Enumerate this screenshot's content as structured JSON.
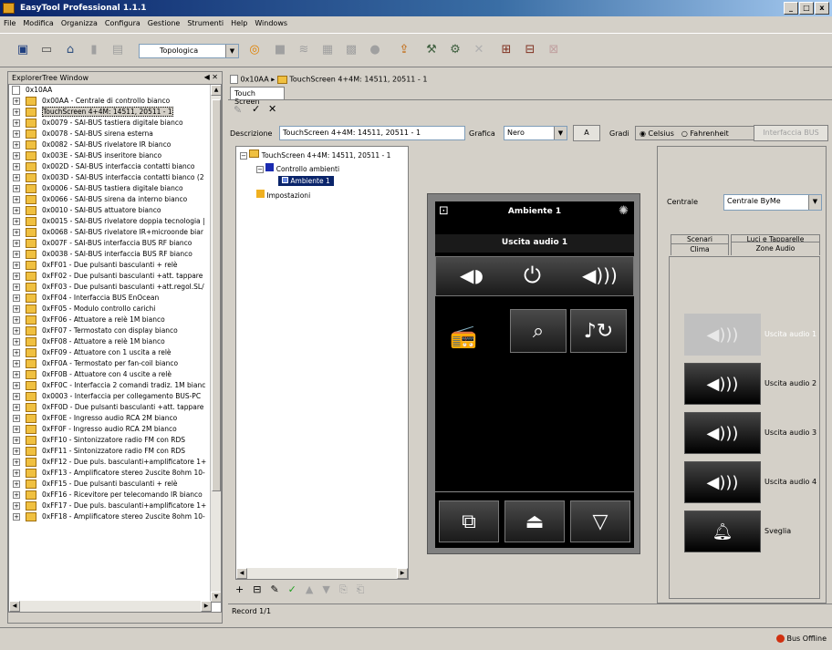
{
  "window": {
    "title": "EasyTool Professional 1.1.1",
    "min": "_",
    "max": "□",
    "close": "x"
  },
  "menu": [
    "File",
    "Modifica",
    "Organizza",
    "Configura",
    "Gestione",
    "Strumenti",
    "Help",
    "Windows"
  ],
  "toolbar": {
    "view_select": "Topologica"
  },
  "explorer": {
    "title": "ExplorerTree Window",
    "root": "0x10AA",
    "items": [
      "0x00AA - Centrale di controllo bianco",
      "TouchScreen 4+4M: 14511, 20511 - 1",
      "0x0079 - SAI-BUS tastiera digitale bianco",
      "0x0078 - SAI-BUS sirena esterna",
      "0x0082 - SAI-BUS rivelatore IR bianco",
      "0x003E - SAI-BUS inseritore bianco",
      "0x002D - SAI-BUS interfaccia contatti bianco",
      "0x003D - SAI-BUS interfaccia contatti bianco (2",
      "0x0006 - SAI-BUS tastiera digitale bianco",
      "0x0066 - SAI-BUS sirena da interno bianco",
      "0x0010 - SAI-BUS attuatore bianco",
      "0x0015 - SAI-BUS rivelatore doppia tecnologia |",
      "0x0068 - SAI-BUS rivelatore IR+microonde biar",
      "0x007F - SAI-BUS interfaccia BUS RF bianco",
      "0x0038 - SAI-BUS interfaccia BUS RF bianco",
      "0xFF01 - Due pulsanti basculanti + relè",
      "0xFF02 - Due pulsanti basculanti +att. tappare",
      "0xFF03 - Due pulsanti basculanti +att.regol.SL/",
      "0xFF04 - Interfaccia BUS EnOcean",
      "0xFF05 - Modulo controllo carichi",
      "0xFF06 - Attuatore a relè 1M bianco",
      "0xFF07 - Termostato con display bianco",
      "0xFF08 - Attuatore a relè 1M bianco",
      "0xFF09 - Attuatore con 1 uscita a relè",
      "0xFF0A - Termostato per fan-coil bianco",
      "0xFF0B - Attuatore con 4 uscite a relè",
      "0xFF0C - Interfaccia 2 comandi tradiz. 1M bianc",
      "0x0003 - Interfaccia per collegamento BUS-PC",
      "0xFF0D - Due pulsanti basculanti +att. tappare",
      "0xFF0E - Ingresso audio RCA 2M bianco",
      "0xFF0F - Ingresso audio RCA 2M bianco",
      "0xFF10 - Sintonizzatore radio FM con RDS",
      "0xFF11 - Sintonizzatore radio FM con RDS",
      "0xFF12 - Due puls. basculanti+amplificatore 1+",
      "0xFF13 - Amplificatore stereo 2uscite 8ohm 10-",
      "0xFF15 - Due pulsanti basculanti + relè",
      "0xFF16 - Ricevitore per telecomando IR bianco",
      "0xFF17 - Due puls. basculanti+amplificatore 1+",
      "0xFF18 - Amplificatore stereo 2uscite 8ohm 10-"
    ]
  },
  "breadcrumb": {
    "root": "0x10AA",
    "device": "TouchScreen 4+4M: 14511, 20511 - 1"
  },
  "tab": "Touch Screen",
  "form": {
    "descr_label": "Descrizione",
    "descr_value": "TouchScreen 4+4M: 14511, 20511 - 1",
    "grafica_label": "Grafica",
    "grafica_value": "Nero",
    "a_btn": "A",
    "gradi_label": "Gradi",
    "celsius": "Celsius",
    "fahrenheit": "Fahrenheit",
    "iface_btn": "Interfaccia BUS"
  },
  "tree2": {
    "root": "TouchScreen 4+4M: 14511, 20511 - 1",
    "controllo": "Controllo ambienti",
    "ambiente": "Ambiente 1",
    "impostazioni": "Impostazioni"
  },
  "device": {
    "title": "Ambiente 1",
    "subtitle": "Uscita audio 1"
  },
  "right": {
    "centrale_label": "Centrale",
    "centrale_value": "Centrale ByMe",
    "tabs_top": [
      "Scenari",
      "Luci e Tapparelle"
    ],
    "tabs_bottom": [
      "Clima",
      "Zone Audio"
    ],
    "audio": [
      "Uscita audio 1",
      "Uscita audio 2",
      "Uscita audio 3",
      "Uscita audio 4",
      "Sveglia"
    ]
  },
  "status": {
    "record": "Record 1/1",
    "bus": "Bus Offline"
  },
  "colors": {
    "title_start": "#0a246a",
    "bus_offline": "#d03010"
  }
}
